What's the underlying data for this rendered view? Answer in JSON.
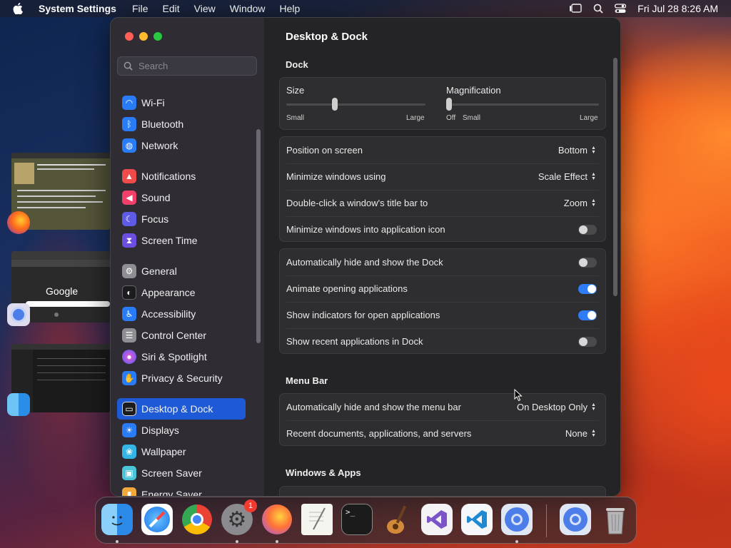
{
  "menubar": {
    "app_name": "System Settings",
    "items": [
      "File",
      "Edit",
      "View",
      "Window",
      "Help"
    ],
    "clock": "Fri Jul 28  8:26 AM"
  },
  "sidebar": {
    "search_placeholder": "Search",
    "items": [
      {
        "label": "Wi-Fi",
        "icon": "wifi-icon",
        "color": "#2a7cf6"
      },
      {
        "label": "Bluetooth",
        "icon": "bluetooth-icon",
        "color": "#2a7cf6"
      },
      {
        "label": "Network",
        "icon": "globe-icon",
        "color": "#2a7cf6"
      },
      {
        "label": "Notifications",
        "icon": "bell-icon",
        "color": "#f04b4b"
      },
      {
        "label": "Sound",
        "icon": "speaker-icon",
        "color": "#f0406a"
      },
      {
        "label": "Focus",
        "icon": "moon-icon",
        "color": "#5e5ce6"
      },
      {
        "label": "Screen Time",
        "icon": "hourglass-icon",
        "color": "#6c4fe0"
      },
      {
        "label": "General",
        "icon": "gear-icon",
        "color": "#8e8e93"
      },
      {
        "label": "Appearance",
        "icon": "appearance-icon",
        "color": "#1c1c1e"
      },
      {
        "label": "Accessibility",
        "icon": "accessibility-icon",
        "color": "#2a7cf6"
      },
      {
        "label": "Control Center",
        "icon": "control-center-icon",
        "color": "#8e8e93"
      },
      {
        "label": "Siri & Spotlight",
        "icon": "siri-icon",
        "color": "#b04cd8"
      },
      {
        "label": "Privacy & Security",
        "icon": "hand-icon",
        "color": "#2a7cf6"
      },
      {
        "label": "Desktop & Dock",
        "icon": "dock-icon",
        "color": "#1c1c1e"
      },
      {
        "label": "Displays",
        "icon": "sun-icon",
        "color": "#2a7cf6"
      },
      {
        "label": "Wallpaper",
        "icon": "wallpaper-icon",
        "color": "#33b5e5"
      },
      {
        "label": "Screen Saver",
        "icon": "screensaver-icon",
        "color": "#4ac6d8"
      },
      {
        "label": "Energy Saver",
        "icon": "battery-icon",
        "color": "#f2a93b"
      }
    ],
    "selected": "Desktop & Dock"
  },
  "content": {
    "title": "Desktop & Dock",
    "dock_section": "Dock",
    "size_label": "Size",
    "size_small": "Small",
    "size_large": "Large",
    "size_value": 0.35,
    "mag_label": "Magnification",
    "mag_off": "Off",
    "mag_small": "Small",
    "mag_large": "Large",
    "mag_value": 0.0,
    "position_label": "Position on screen",
    "position_value": "Bottom",
    "minimize_label": "Minimize windows using",
    "minimize_value": "Scale Effect",
    "doubleclick_label": "Double-click a window's title bar to",
    "doubleclick_value": "Zoom",
    "minimize_into_icon_label": "Minimize windows into application icon",
    "autohide_label": "Automatically hide and show the Dock",
    "animate_label": "Animate opening applications",
    "indicators_label": "Show indicators for open applications",
    "recent_label": "Show recent applications in Dock",
    "menubar_section": "Menu Bar",
    "menubar_autohide_label": "Automatically hide and show the menu bar",
    "menubar_autohide_value": "On Desktop Only",
    "recent_docs_label": "Recent documents, applications, and servers",
    "recent_docs_value": "None",
    "windows_apps_section": "Windows & Apps"
  },
  "toggles": {
    "minimize_into_icon": false,
    "autohide": false,
    "animate": true,
    "indicators": true,
    "recent": false
  },
  "thumbnails": {
    "google_logo": "Google"
  },
  "dock": {
    "apps": [
      {
        "name": "finder-icon"
      },
      {
        "name": "safari-icon"
      },
      {
        "name": "chrome-icon"
      },
      {
        "name": "system-settings-icon",
        "badge": "1"
      },
      {
        "name": "firefox-icon"
      },
      {
        "name": "textedit-icon"
      },
      {
        "name": "terminal-icon"
      },
      {
        "name": "garageband-icon"
      },
      {
        "name": "visual-studio-icon"
      },
      {
        "name": "vscode-icon"
      },
      {
        "name": "chromium-icon"
      },
      {
        "name": "chromium-minimized-icon"
      },
      {
        "name": "trash-icon"
      }
    ]
  }
}
